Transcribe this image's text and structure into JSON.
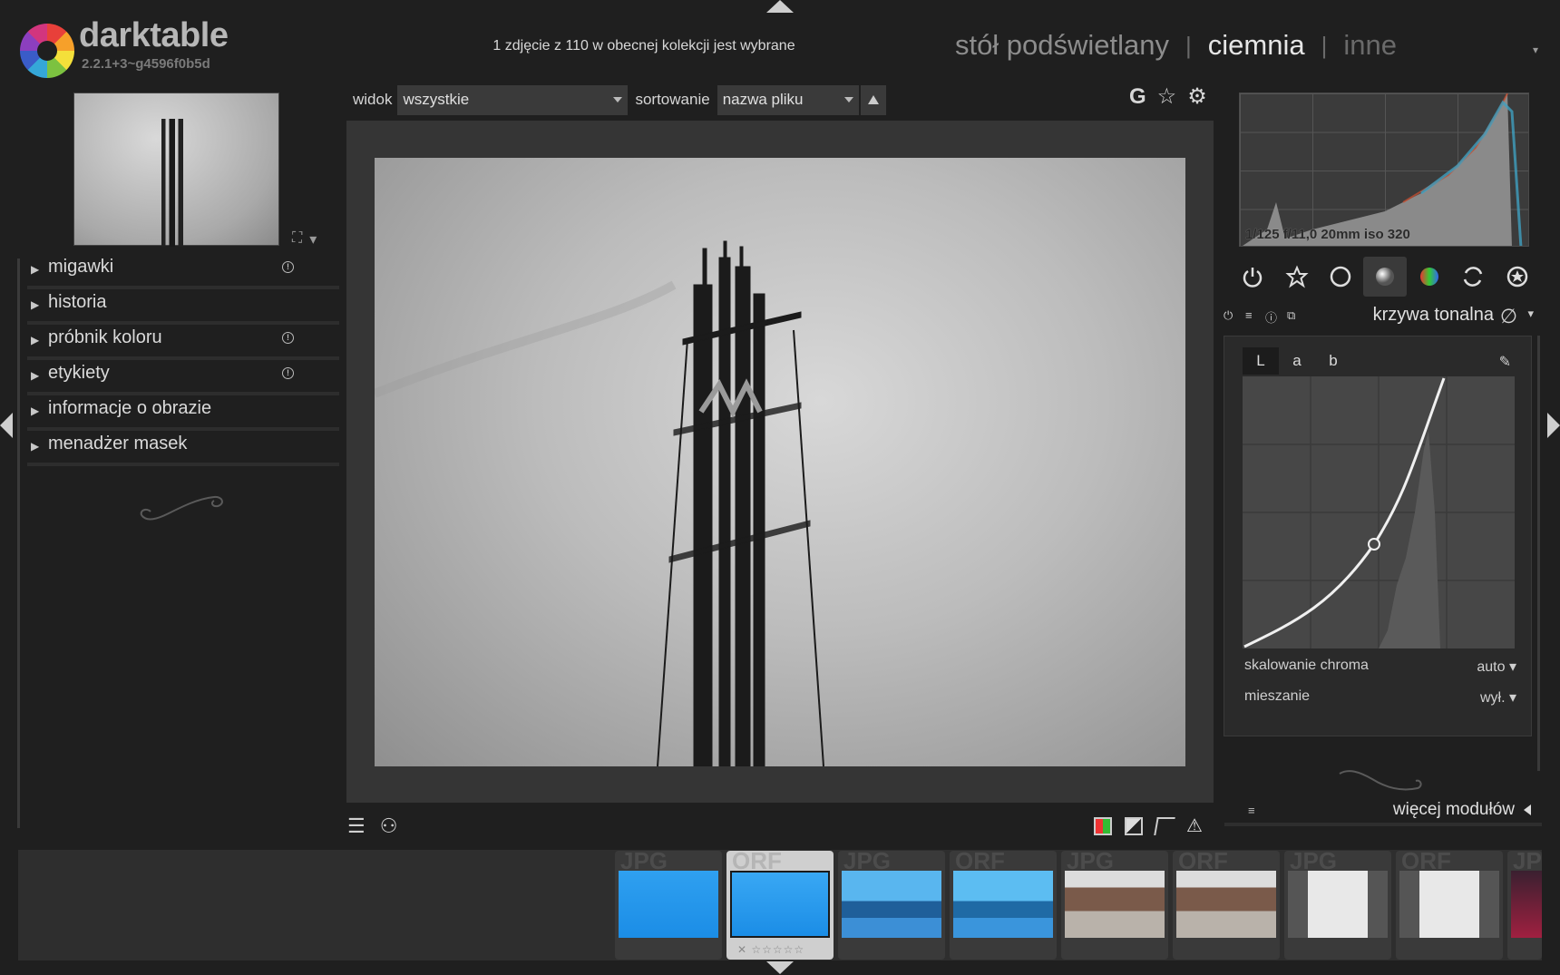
{
  "app": {
    "name": "darktable",
    "version": "2.2.1+3~g4596f0b5d"
  },
  "status_text": "1 zdjęcie z 110 w obecnej kolekcji jest wybrane",
  "views": {
    "lighttable": "stół podświetlany",
    "sep1": "|",
    "darkroom": "ciemnia",
    "sep2": "|",
    "other": "inne"
  },
  "header_menu": "▾",
  "left_modules": [
    {
      "label": "migawki",
      "info": "!"
    },
    {
      "label": "historia"
    },
    {
      "label": "próbnik koloru",
      "info": "!"
    },
    {
      "label": "etykiety",
      "info": "!"
    },
    {
      "label": "informacje o obrazie"
    },
    {
      "label": "menadżer masek"
    }
  ],
  "filter": {
    "view_label": "widok",
    "view_value": "wszystkie",
    "sort_label": "sortowanie",
    "sort_value": "nazwa pliku"
  },
  "top_icons": {
    "g": "G",
    "star": "☆",
    "gear": "⚙"
  },
  "histogram": {
    "exif": "1/125 f/11,0 20mm iso 320"
  },
  "module": {
    "title": "krzywa tonalna",
    "tabs": [
      "L",
      "a",
      "b"
    ],
    "active_tab": "L",
    "rows": [
      {
        "label": "skalowanie chroma",
        "value": "auto"
      },
      {
        "label": "mieszanie",
        "value": "wył."
      }
    ]
  },
  "more_modules": "więcej modułów",
  "filmstrip": [
    {
      "ext": "JPG",
      "selected": false,
      "tone": "blue"
    },
    {
      "ext": "ORF",
      "selected": true,
      "tone": "blue",
      "stars": "✕ ☆☆☆☆☆"
    },
    {
      "ext": "JPG",
      "selected": false,
      "tone": "blue-wide"
    },
    {
      "ext": "ORF",
      "selected": false,
      "tone": "blue-wide"
    },
    {
      "ext": "JPG",
      "selected": false,
      "tone": "flags"
    },
    {
      "ext": "ORF",
      "selected": false,
      "tone": "flags"
    },
    {
      "ext": "JPG",
      "selected": false,
      "tone": "street"
    },
    {
      "ext": "ORF",
      "selected": false,
      "tone": "street"
    },
    {
      "ext": "JPG",
      "selected": false,
      "tone": "night"
    }
  ],
  "colors": {
    "bg": "#1f1f1f",
    "panel": "#2a2a2a",
    "accent": "#e6e6e6"
  }
}
